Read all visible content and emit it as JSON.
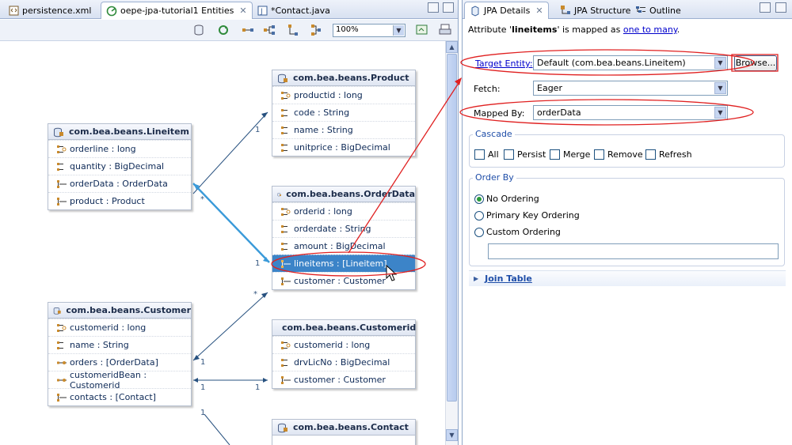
{
  "left_tabs": [
    {
      "label": "persistence.xml"
    },
    {
      "label": "oepe-jpa-tutorial1 Entities"
    },
    {
      "label": "*Contact.java"
    }
  ],
  "toolbar": {
    "zoom": "100%"
  },
  "entities": {
    "product": {
      "title": "com.bea.beans.Product",
      "attrs": [
        "productid : long",
        "code : String",
        "name : String",
        "unitprice : BigDecimal"
      ]
    },
    "lineitem": {
      "title": "com.bea.beans.Lineitem",
      "attrs": [
        "orderline : long",
        "quantity : BigDecimal",
        "orderData : OrderData",
        "product : Product"
      ]
    },
    "orderdata": {
      "title": "com.bea.beans.OrderData",
      "attrs": [
        "orderid : long",
        "orderdate : String",
        "amount : BigDecimal",
        "lineitems : [Lineitem]",
        "customer : Customer"
      ]
    },
    "customer": {
      "title": "com.bea.beans.Customer",
      "attrs": [
        "customerid : long",
        "name : String",
        "orders : [OrderData]",
        "customeridBean : Customerid",
        "contacts : [Contact]"
      ]
    },
    "customerid": {
      "title": "com.bea.beans.Customerid",
      "attrs": [
        "customerid : long",
        "drvLicNo : BigDecimal",
        "customer : Customer"
      ]
    },
    "contact": {
      "title": "com.bea.beans.Contact",
      "attrs": []
    }
  },
  "multiplicity": {
    "one": "1",
    "many": "*"
  },
  "right_tabs": [
    {
      "label": "JPA Details"
    },
    {
      "label": "JPA Structure"
    },
    {
      "label": "Outline"
    }
  ],
  "details": {
    "attr_prefix": "Attribute '",
    "attr_name": "lineitems",
    "attr_mid": "' is mapped as ",
    "mapping_link": "one to many",
    "attr_end": ".",
    "target_entity_label": "Target Entity:",
    "target_entity_value": "Default (com.bea.beans.Lineitem)",
    "browse_label": "Browse...",
    "fetch_label": "Fetch:",
    "fetch_value": "Eager",
    "mapped_by_label": "Mapped By:",
    "mapped_by_value": "orderData",
    "cascade_title": "Cascade",
    "cascade": [
      "All",
      "Persist",
      "Merge",
      "Remove",
      "Refresh"
    ],
    "order_by_title": "Order By",
    "order_options": [
      "No Ordering",
      "Primary Key Ordering",
      "Custom Ordering"
    ],
    "order_selected": 0,
    "join_table_label": "Join Table"
  },
  "colors": {
    "accent_red": "#e02020",
    "selection": "#3c84c8",
    "link": "#0000cc",
    "connector": "#27517f",
    "connector_highlight": "#3a9ad9"
  }
}
